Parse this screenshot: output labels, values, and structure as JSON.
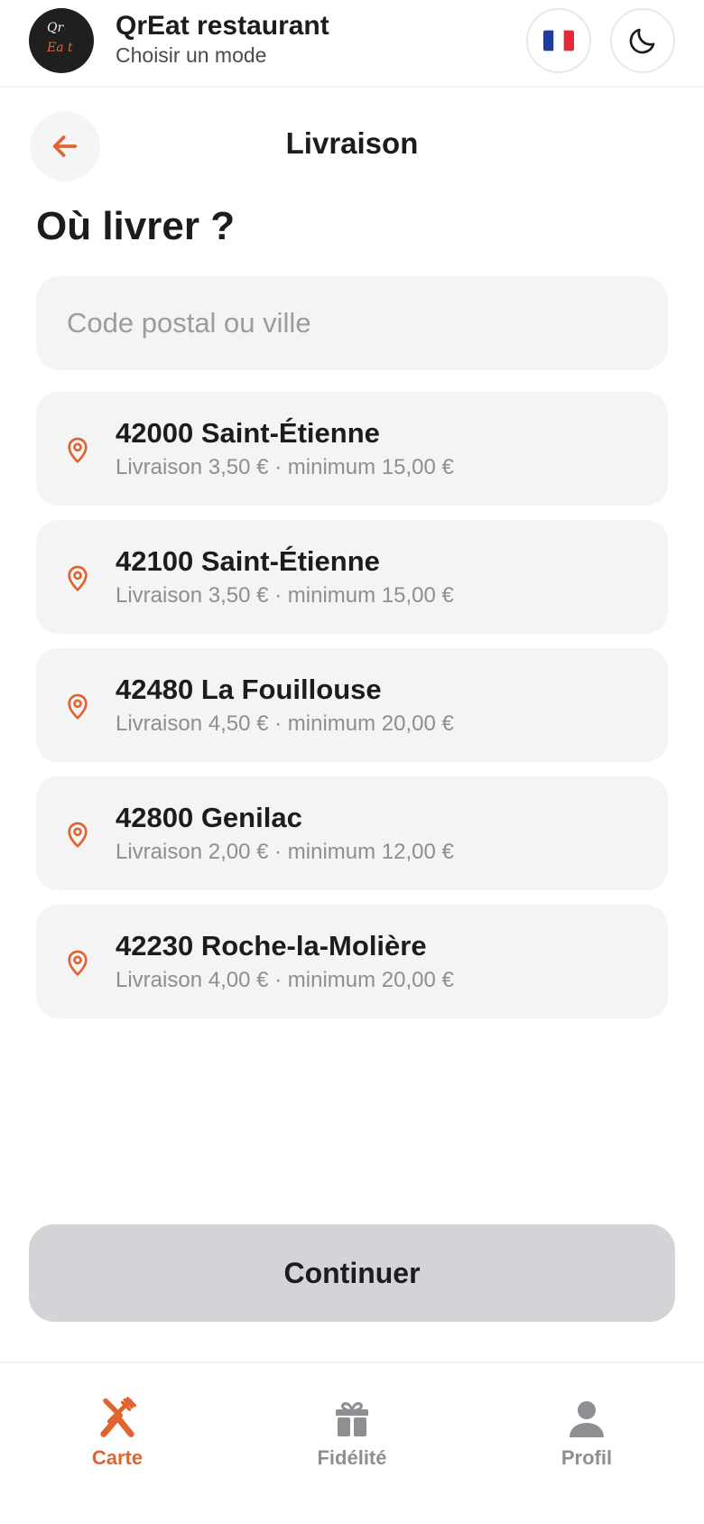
{
  "header": {
    "logo_top": "Qr",
    "logo_bottom": "Ea t",
    "title": "QrEat restaurant",
    "subtitle": "Choisir un mode",
    "flag": "🇫🇷"
  },
  "page": {
    "title": "Livraison",
    "heading": "Où livrer ?"
  },
  "search": {
    "placeholder": "Code postal ou ville",
    "value": ""
  },
  "zones": [
    {
      "name": "42000 Saint-Étienne",
      "meta": "Livraison 3,50 € · minimum 15,00 €"
    },
    {
      "name": "42100 Saint-Étienne",
      "meta": "Livraison 3,50 € · minimum 15,00 €"
    },
    {
      "name": "42480 La Fouillouse",
      "meta": "Livraison 4,50 € · minimum 20,00 €"
    },
    {
      "name": "42800 Genilac",
      "meta": "Livraison 2,00 € · minimum 12,00 €"
    },
    {
      "name": "42230 Roche-la-Molière",
      "meta": "Livraison 4,00 € · minimum 20,00 €"
    }
  ],
  "actions": {
    "continue": "Continuer"
  },
  "tabs": [
    {
      "label": "Carte",
      "icon": "fork-knife-icon",
      "active": true
    },
    {
      "label": "Fidélité",
      "icon": "gift-icon",
      "active": false
    },
    {
      "label": "Profil",
      "icon": "person-icon",
      "active": false
    }
  ],
  "colors": {
    "accent": "#e0642f",
    "inactive": "#8e8e93",
    "card": "#f4f4f5",
    "button_disabled": "#d4d4d8"
  }
}
